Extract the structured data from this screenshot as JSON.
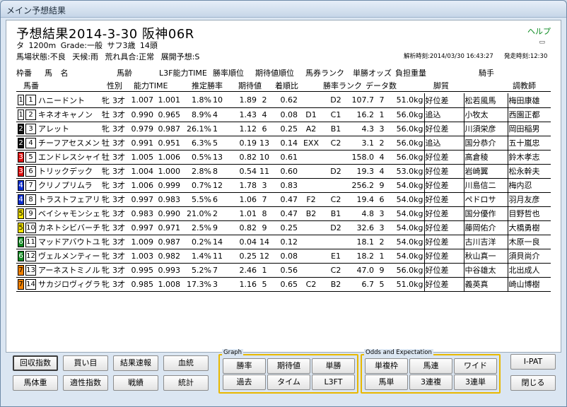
{
  "window": {
    "title": "メイン予想結果"
  },
  "header": {
    "title": "予想結果2014-3-30 阪神06R",
    "help": "ヘルプ",
    "line1": "タ 1200m  Grade:一般  サフ3歳  14頭",
    "line2": "馬場状態:不良  天候:雨  荒れ具合:正常  展開予想:S",
    "calc_time": "解析時刻:2014/03/30 16:43:27",
    "start_time": "発走時刻:12:30"
  },
  "columns": {
    "row1": [
      "枠番",
      "馬 名",
      "馬齢",
      "L3F能力TIME",
      "勝率順位",
      "期待値順位",
      "馬券ランク",
      "単勝オッズ",
      "負担重量",
      "騎手"
    ],
    "row2": [
      "馬番",
      "性別",
      "能力TIME",
      "推定勝率",
      "期待値",
      "着順比",
      "勝率ランク",
      "データ数",
      "脚質",
      "調教師"
    ]
  },
  "rows": [
    {
      "waku": "1",
      "num": "1",
      "name": "ハニードント",
      "sex": "牝",
      "age": "3才",
      "ability": "1.007",
      "l3f": "1.001",
      "win": "1.8%",
      "wr": "10",
      "ev": "1.89",
      "er": "2",
      "ratio": "0.62",
      "ticket": "",
      "wrank": "D2",
      "odds": "107.7",
      "data": "7",
      "weight": "51.0kg",
      "style": "好位差",
      "jockey": "松若風馬",
      "trainer": "梅田康雄"
    },
    {
      "waku": "1",
      "num": "2",
      "name": "キネオキャノン",
      "sex": "牡",
      "age": "3才",
      "ability": "0.990",
      "l3f": "0.965",
      "win": "8.9%",
      "wr": "4",
      "ev": "1.43",
      "er": "4",
      "ratio": "0.08",
      "ticket": "D1",
      "wrank": "C1",
      "odds": "16.2",
      "data": "1",
      "weight": "56.0kg",
      "style": "追込",
      "jockey": "小牧太",
      "trainer": "西園正都"
    },
    {
      "waku": "2",
      "num": "3",
      "name": "アレット",
      "sex": "牝",
      "age": "3才",
      "ability": "0.979",
      "l3f": "0.987",
      "win": "26.1%",
      "wr": "1",
      "ev": "1.12",
      "er": "6",
      "ratio": "0.25",
      "ticket": "A2",
      "wrank": "B1",
      "odds": "4.3",
      "data": "3",
      "weight": "56.0kg",
      "style": "好位差",
      "jockey": "川須栄彦",
      "trainer": "岡田稲男"
    },
    {
      "waku": "2",
      "num": "4",
      "name": "チーフアセスメント",
      "sex": "牡",
      "age": "3才",
      "ability": "0.991",
      "l3f": "0.951",
      "win": "6.3%",
      "wr": "5",
      "ev": "0.19",
      "er": "13",
      "ratio": "0.14",
      "ticket": "EXX",
      "wrank": "C2",
      "odds": "3.1",
      "data": "2",
      "weight": "56.0kg",
      "style": "追込",
      "jockey": "国分恭介",
      "trainer": "五十嵐忠"
    },
    {
      "waku": "3",
      "num": "5",
      "name": "エンドレスシャイン",
      "sex": "牡",
      "age": "3才",
      "ability": "1.005",
      "l3f": "1.006",
      "win": "0.5%",
      "wr": "13",
      "ev": "0.82",
      "er": "10",
      "ratio": "0.61",
      "ticket": "",
      "wrank": "",
      "odds": "158.0",
      "data": "4",
      "weight": "56.0kg",
      "style": "好位差",
      "jockey": "高倉稜",
      "trainer": "鈴木孝志"
    },
    {
      "waku": "3",
      "num": "6",
      "name": "トリックデック",
      "sex": "牝",
      "age": "3才",
      "ability": "1.004",
      "l3f": "1.000",
      "win": "2.8%",
      "wr": "8",
      "ev": "0.54",
      "er": "11",
      "ratio": "0.60",
      "ticket": "",
      "wrank": "D2",
      "odds": "19.3",
      "data": "4",
      "weight": "53.0kg",
      "style": "好位差",
      "jockey": "岩崎翼",
      "trainer": "松永幹夫"
    },
    {
      "waku": "4",
      "num": "7",
      "name": "クリノプリムラ",
      "sex": "牝",
      "age": "3才",
      "ability": "1.006",
      "l3f": "0.999",
      "win": "0.7%",
      "wr": "12",
      "ev": "1.78",
      "er": "3",
      "ratio": "0.83",
      "ticket": "",
      "wrank": "",
      "odds": "256.2",
      "data": "9",
      "weight": "54.0kg",
      "style": "好位差",
      "jockey": "川島信二",
      "trainer": "梅内忍"
    },
    {
      "waku": "4",
      "num": "8",
      "name": "トラストフェアリー",
      "sex": "牝",
      "age": "3才",
      "ability": "0.997",
      "l3f": "0.983",
      "win": "5.5%",
      "wr": "6",
      "ev": "1.06",
      "er": "7",
      "ratio": "0.47",
      "ticket": "F2",
      "wrank": "C2",
      "odds": "19.4",
      "data": "6",
      "weight": "54.0kg",
      "style": "好位差",
      "jockey": "ペドロサ",
      "trainer": "羽月友彦"
    },
    {
      "waku": "5",
      "num": "9",
      "name": "ベイシャモンシェリ",
      "sex": "牝",
      "age": "3才",
      "ability": "0.983",
      "l3f": "0.990",
      "win": "21.0%",
      "wr": "2",
      "ev": "1.01",
      "er": "8",
      "ratio": "0.47",
      "ticket": "B2",
      "wrank": "B1",
      "odds": "4.8",
      "data": "3",
      "weight": "54.0kg",
      "style": "好位差",
      "jockey": "国分優作",
      "trainer": "目野哲也"
    },
    {
      "waku": "5",
      "num": "10",
      "name": "カネトシビバーチェ",
      "sex": "牝",
      "age": "3才",
      "ability": "0.997",
      "l3f": "0.971",
      "win": "2.5%",
      "wr": "9",
      "ev": "0.82",
      "er": "9",
      "ratio": "0.25",
      "ticket": "",
      "wrank": "D2",
      "odds": "32.6",
      "data": "3",
      "weight": "54.0kg",
      "style": "好位差",
      "jockey": "藤岡佑介",
      "trainer": "大橋勇樹"
    },
    {
      "waku": "6",
      "num": "11",
      "name": "マッドアバウトユー",
      "sex": "牝",
      "age": "3才",
      "ability": "1.009",
      "l3f": "0.987",
      "win": "0.2%",
      "wr": "14",
      "ev": "0.04",
      "er": "14",
      "ratio": "0.12",
      "ticket": "",
      "wrank": "",
      "odds": "18.1",
      "data": "2",
      "weight": "54.0kg",
      "style": "好位差",
      "jockey": "古川吉洋",
      "trainer": "木原一良"
    },
    {
      "waku": "6",
      "num": "12",
      "name": "ヴェルメンティーノ",
      "sex": "牝",
      "age": "3才",
      "ability": "1.003",
      "l3f": "0.982",
      "win": "1.4%",
      "wr": "11",
      "ev": "0.25",
      "er": "12",
      "ratio": "0.08",
      "ticket": "",
      "wrank": "E1",
      "odds": "18.2",
      "data": "1",
      "weight": "54.0kg",
      "style": "好位差",
      "jockey": "秋山真一",
      "trainer": "須貝尚介"
    },
    {
      "waku": "7",
      "num": "13",
      "name": "アーネストミノル",
      "sex": "牝",
      "age": "3才",
      "ability": "0.995",
      "l3f": "0.993",
      "win": "5.2%",
      "wr": "7",
      "ev": "2.46",
      "er": "1",
      "ratio": "0.56",
      "ticket": "",
      "wrank": "C2",
      "odds": "47.0",
      "data": "9",
      "weight": "56.0kg",
      "style": "好位差",
      "jockey": "中谷雄太",
      "trainer": "北出成人"
    },
    {
      "waku": "7",
      "num": "14",
      "name": "サカジロヴィグラス",
      "sex": "牝",
      "age": "3才",
      "ability": "0.985",
      "l3f": "1.008",
      "win": "17.3%",
      "wr": "3",
      "ev": "1.16",
      "er": "5",
      "ratio": "0.65",
      "ticket": "C2",
      "wrank": "B2",
      "odds": "6.7",
      "data": "5",
      "weight": "51.0kg",
      "style": "好位差",
      "jockey": "義英真",
      "trainer": "崎山博樹"
    }
  ],
  "waku_colors": {
    "1": "#ffffff",
    "2": "#111111",
    "3": "#e01010",
    "4": "#1030d0",
    "5": "#f0e000",
    "6": "#108a20",
    "7": "#f08000",
    "8": "#f0a0b0"
  },
  "waku_text_colors": {
    "1": "#000000",
    "2": "#ffffff",
    "3": "#ffffff",
    "4": "#ffffff",
    "5": "#000000",
    "6": "#ffffff",
    "7": "#000000",
    "8": "#000000"
  },
  "buttons": {
    "recovery": "回収指数",
    "buy": "買い目",
    "result_fast": "結果速報",
    "pedigree": "血統",
    "horse_weight": "馬体重",
    "aptitude": "適性指数",
    "record": "戦績",
    "stats": "統計",
    "win_rate": "勝率",
    "expectation": "期待値",
    "tansho": "単勝",
    "past": "過去",
    "time": "タイム",
    "l3ft": "L3FT",
    "fukusho_waku": "単複枠",
    "umaren": "馬連",
    "wide": "ワイド",
    "umatan": "馬単",
    "sanrenpuku": "3連複",
    "sanrentan": "3連単",
    "ipat": "I-PAT",
    "close": "閉じる"
  },
  "groups": {
    "graph": "Graph",
    "odds": "Odds and Expectation"
  }
}
